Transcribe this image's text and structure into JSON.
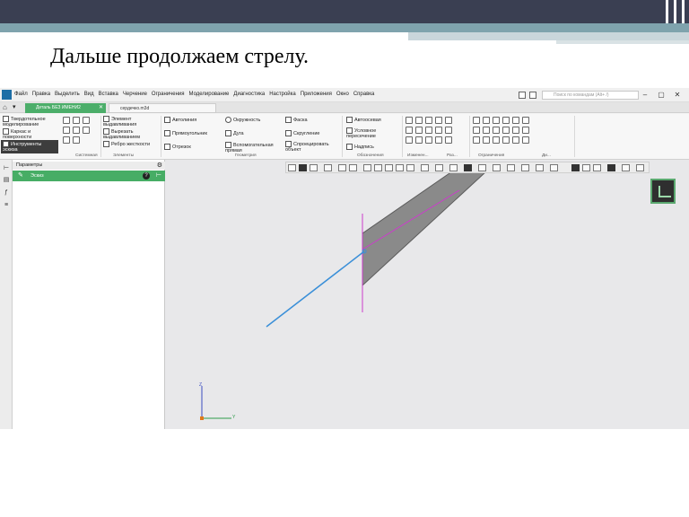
{
  "slide": {
    "title": "Дальше продолжаем стрелу."
  },
  "app": {
    "menu": [
      "Файл",
      "Правка",
      "Выделить",
      "Вид",
      "Вставка",
      "Черчение",
      "Ограничения",
      "Моделирование",
      "Диагностика",
      "Настройка",
      "Приложения",
      "Окно",
      "Справка"
    ],
    "search_placeholder": "Поиск по командам (Alt+ /)",
    "tabs": {
      "active": "Деталь БЕЗ ИМЕНИ2",
      "inactive": "сердечко.m3d"
    },
    "ribbon": {
      "modes": [
        "Твердотельное моделирование",
        "Каркас и поверхности",
        "Инструменты эскиза"
      ],
      "elements": [
        "Элемент выдавливания",
        "Вырезать выдавливанием",
        "Ребро жесткости"
      ],
      "geometry": [
        "Автолиния",
        "Прямоугольник",
        "Отрезок",
        "Окружность",
        "Дуга",
        "Вспомогательная прямая",
        "Фаска",
        "Скругление",
        "Спроецировать объект"
      ],
      "annotations": [
        "Автоосевая",
        "Условное пересечение",
        "Надпись"
      ],
      "groups": [
        "Системная",
        "Элементы",
        "Геометрия",
        "Обозначения",
        "Изменен...",
        "Раз...",
        "Ограничения",
        "Ди..."
      ]
    },
    "panel": {
      "header": "Параметры",
      "sketch_label": "Эскиз"
    },
    "axes": {
      "z": "Z",
      "y": "Y"
    }
  },
  "colors": {
    "title_bar_dark": "#3a3f52",
    "teal_band": "#7fa3ad",
    "kompas_green": "#47ad65",
    "construction_line": "#cc3ccc",
    "sketch_line": "#3a8fd8",
    "solid_face": "#8a8a8a"
  }
}
